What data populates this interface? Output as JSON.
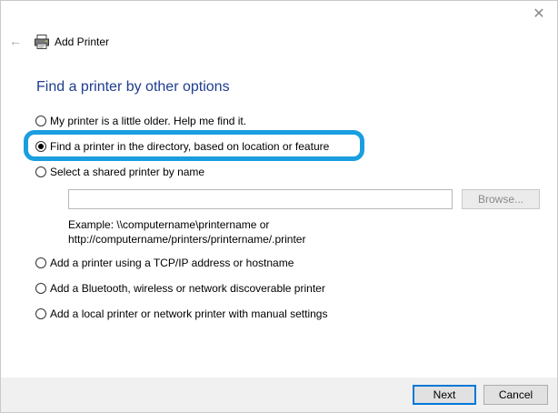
{
  "window": {
    "title": "Add Printer",
    "close_glyph": "✕",
    "back_glyph": "←"
  },
  "heading": "Find a printer by other options",
  "options": [
    {
      "label": "My printer is a little older. Help me find it.",
      "checked": false
    },
    {
      "label": "Find a printer in the directory, based on location or feature",
      "checked": true
    },
    {
      "label": "Select a shared printer by name",
      "checked": false
    },
    {
      "label": "Add a printer using a TCP/IP address or hostname",
      "checked": false
    },
    {
      "label": "Add a Bluetooth, wireless or network discoverable printer",
      "checked": false
    },
    {
      "label": "Add a local printer or network printer with manual settings",
      "checked": false
    }
  ],
  "shared_printer": {
    "input_value": "",
    "browse_label": "Browse...",
    "example_line1": "Example: \\\\computername\\printername or",
    "example_line2": "http://computername/printers/printername/.printer"
  },
  "footer": {
    "next_label": "Next",
    "cancel_label": "Cancel"
  },
  "colors": {
    "heading": "#1e3d8f",
    "highlight": "#1a9ee0",
    "default_button_border": "#0078d7"
  },
  "icons": {
    "title_icon": "printer-icon",
    "back": "back-arrow-icon",
    "close": "close-icon"
  }
}
